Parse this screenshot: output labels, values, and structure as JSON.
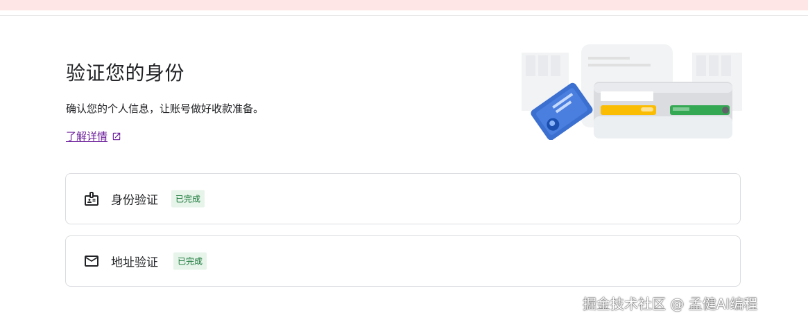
{
  "header": {
    "title": "验证您的身份",
    "description": "确认您的个人信息，让账号做好收款准备。",
    "learn_more_label": "了解详情"
  },
  "verification_items": [
    {
      "label": "身份验证",
      "status": "已完成",
      "icon": "id-card-icon"
    },
    {
      "label": "地址验证",
      "status": "已完成",
      "icon": "mail-icon"
    }
  ],
  "colors": {
    "banner": "#fde6e5",
    "link": "#6a1b9a",
    "status_bg": "#e6f4ea",
    "status_text": "#137333",
    "card_border": "#dadce0"
  },
  "watermark": "掘金技术社区 @ 孟健AI编程"
}
